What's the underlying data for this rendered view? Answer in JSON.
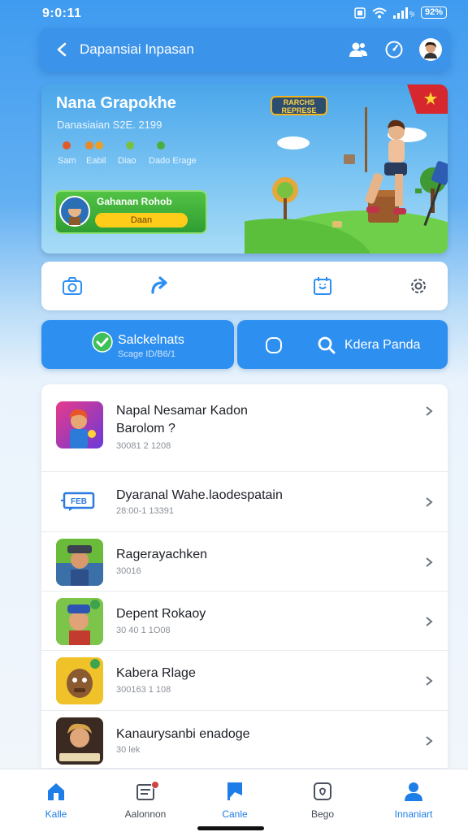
{
  "status_bar": {
    "time": "9:0:11",
    "battery": "92%"
  },
  "header": {
    "title": "Dapansiai Inpasan"
  },
  "banner": {
    "title": "Nana Grapokhe",
    "subtitle": "Danasiaian S2E. 2199",
    "dot_labels": [
      "Sam",
      "Eabil",
      "Diao",
      "Dado Erage"
    ],
    "badge": "RARCHS REPRESE",
    "promo_title": "Gahanan Rohob",
    "promo_button": "Daan",
    "colors": {
      "dot1": "#e05a2b",
      "dot2": "#e88a2a",
      "dot3": "#7ac142",
      "dot4": "#4cae3c"
    }
  },
  "actions": {
    "left_title": "Salckelnats",
    "left_sub": "Scage ID/B6/1",
    "right_title": "Kdera Panda"
  },
  "list": [
    {
      "title": "Napal Nesamar Kadon",
      "title2": "Barolom ?",
      "sub": "30081 2 1208"
    },
    {
      "title": "Dyaranal Wahe.laodespatain",
      "sub": "28:00-1 13391"
    },
    {
      "title": "Ragerayachken",
      "sub": "30016"
    },
    {
      "title": "Depent Rokaoy",
      "sub": "30 40 1 1O08"
    },
    {
      "title": "Kabera Rlage",
      "sub": "300163 1 108"
    },
    {
      "title": "Kanaurysanbi enadoge",
      "sub": "30 lek"
    }
  ],
  "nav": [
    {
      "label": "Kalle"
    },
    {
      "label": "Aalonnon"
    },
    {
      "label": "Canle"
    },
    {
      "label": "Bego"
    },
    {
      "label": "Innaniart"
    }
  ],
  "icons": [
    "back-icon",
    "users-icon",
    "compass-icon",
    "avatar",
    "camera-icon",
    "redo-icon",
    "calendar-icon",
    "gear-icon",
    "check-icon",
    "record-icon",
    "search-icon",
    "chevron-right-icon",
    "home-icon",
    "inbox-icon",
    "flag-icon",
    "badge-icon",
    "profile-icon"
  ],
  "accent": "#2d8ff0"
}
